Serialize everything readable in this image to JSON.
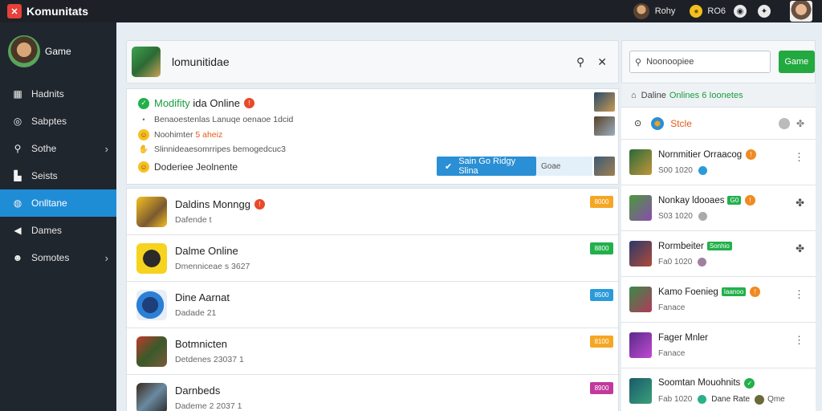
{
  "app": {
    "title": "Komunitats",
    "logo_icon": "puzzle-icon"
  },
  "topbar": {
    "username": "Rohy",
    "coins": "RO6"
  },
  "sidebar": {
    "profile_name": "Game",
    "items": [
      {
        "label": "Hadnits",
        "icon": "grid-icon"
      },
      {
        "label": "Sabptes",
        "icon": "target-icon"
      },
      {
        "label": "Sothe",
        "icon": "search-icon",
        "chevron": true
      },
      {
        "label": "Seists",
        "icon": "chart-icon"
      },
      {
        "label": "Onlltane",
        "icon": "globe-icon",
        "active": true
      },
      {
        "label": "Dames",
        "icon": "megaphone-icon"
      },
      {
        "label": "Somotes",
        "icon": "smile-icon",
        "chevron": true
      }
    ]
  },
  "search_card": {
    "title": "lomunitidae"
  },
  "notification": {
    "title_green": "Modifity",
    "title_rest": "ida Online",
    "line1": "Benaoestenlas Lanuqe oenaoe 1dcid",
    "line2_a": "Noohimter",
    "line2_b": "5 aheiz",
    "line3": "Slinnideaesomrripes bemogedcuc3",
    "line4": "Doderiee Jeolnente",
    "join_label": "Sain Go Ridgy Slina",
    "join_side": "Goae"
  },
  "games": [
    {
      "name": "Daldins Monngg",
      "meta": "Dafende t",
      "badge": "8000",
      "badge_color": "#f5a623",
      "has_red": true
    },
    {
      "name": "Dalme Online",
      "meta": "Dmenniceae s 3627",
      "badge": "8800",
      "badge_color": "#22b04b",
      "has_red": false
    },
    {
      "name": "Dine Aarnat",
      "meta": "Dadade 21",
      "badge": "8500",
      "badge_color": "#2a9bd8",
      "has_red": false
    },
    {
      "name": "Botmnicten",
      "meta": "Detdenes 23037 1",
      "badge": "8100",
      "badge_color": "#f5a623",
      "has_red": false
    },
    {
      "name": "Darnbeds",
      "meta": "Dademe 2 2037 1",
      "badge": "8900",
      "badge_color": "#c2399c",
      "has_red": false
    }
  ],
  "right_panel": {
    "search_placeholder": "Noonoopiee",
    "button_label": "Game",
    "online_prefix": "Daline",
    "online_count": "Onlines 6 Ioonetes",
    "head_name": "Stcle"
  },
  "friends": [
    {
      "name": "Nornmitier Orraacog",
      "meta": "S00 1020"
    },
    {
      "name": "Nonkay ldooaes",
      "meta": "S03 1020",
      "tag": "G0"
    },
    {
      "name": "Rormbeiter",
      "meta": "Fa0 1020",
      "pill": "Sonhio"
    },
    {
      "name": "Kamo Foenieg",
      "meta": "Fanace",
      "pill": "Iaanoo"
    },
    {
      "name": "Fager Mnler",
      "meta": "Fanace"
    },
    {
      "name": "Soomtan Mouohnits",
      "meta": "Fab 1020",
      "extra": "Dane Rate",
      "extra2": "Qme"
    }
  ]
}
